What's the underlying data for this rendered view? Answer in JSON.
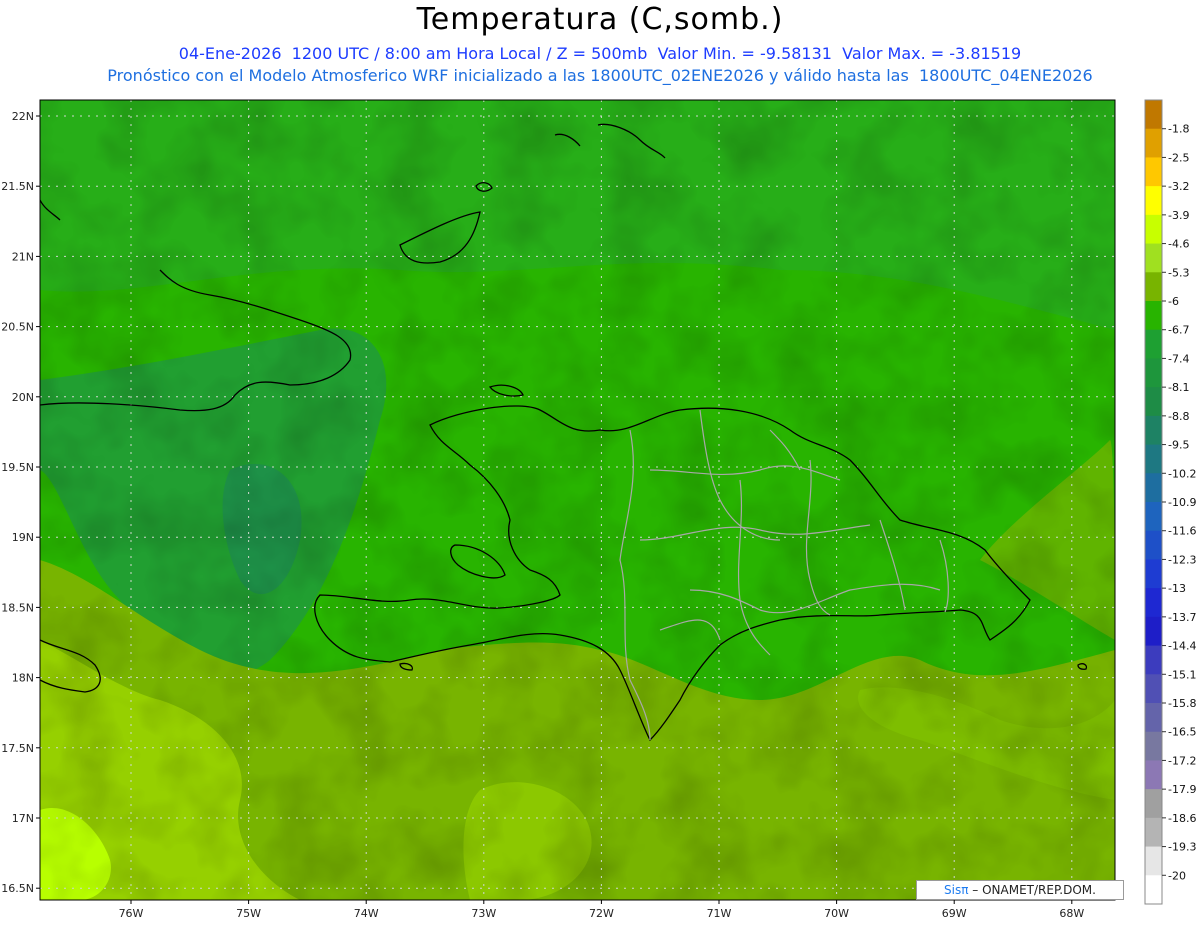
{
  "header": {
    "title": "Temperatura (C,somb.)",
    "line1": "04-Ene-2026  1200 UTC / 8:00 am Hora Local / Z = 500mb  Valor Min. = -9.58131  Valor Max. = -3.81519",
    "line2": "Pronóstico con el Modelo Atmosferico WRF inicializado a las 1800UTC_02ENE2026 y válido hasta las  1800UTC_04ENE2026"
  },
  "map": {
    "lat_labels": [
      "22N",
      "21.5N",
      "21N",
      "20.5N",
      "20N",
      "19.5N",
      "19N",
      "18.5N",
      "18N",
      "17.5N",
      "17N",
      "16.5N"
    ],
    "lon_labels": [
      "76W",
      "75W",
      "74W",
      "73W",
      "72W",
      "71W",
      "70W",
      "69W",
      "68W"
    ],
    "colors": {
      "coast": "#000000",
      "provinces": "#a8a8a8",
      "grid": "#cfd8cf"
    }
  },
  "colorbar": {
    "labels": [
      "-1.8",
      "-2.5",
      "-3.2",
      "-3.9",
      "-4.6",
      "-5.3",
      "-6",
      "-6.7",
      "-7.4",
      "-8.1",
      "-8.8",
      "-9.5",
      "-10.2",
      "-10.9",
      "-11.6",
      "-12.3",
      "-13",
      "-13.7",
      "-14.4",
      "-15.1",
      "-15.8",
      "-16.5",
      "-17.2",
      "-17.9",
      "-18.6",
      "-19.3",
      "-20"
    ],
    "colors": [
      "#c07800",
      "#e0a000",
      "#ffc800",
      "#ffff00",
      "#c8ff00",
      "#a0e020",
      "#78b400",
      "#28b400",
      "#1ea032",
      "#1e963c",
      "#1e8c46",
      "#1e8264",
      "#1e7882",
      "#1e6ea0",
      "#1e64be",
      "#1e50c8",
      "#1e3cd2",
      "#1e28d2",
      "#1e1ec8",
      "#3c3cbe",
      "#5050b4",
      "#6464aa",
      "#7878a0",
      "#8c78b4",
      "#a0a0a0",
      "#b4b4b4",
      "#e6e6e6",
      "#ffffff"
    ]
  },
  "credit": {
    "sis": "Sisπ",
    "org": "– ONAMET/REP.DOM."
  }
}
